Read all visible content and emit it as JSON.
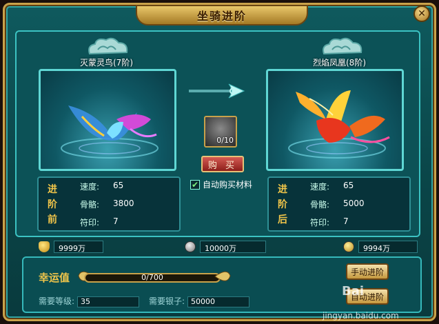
{
  "window": {
    "title": "坐骑进阶"
  },
  "left_mount": {
    "name": "灭蒙灵鸟(7阶)",
    "tag": "进\n阶\n前",
    "stats": [
      {
        "label": "速度:",
        "value": "65"
      },
      {
        "label": "骨骼:",
        "value": "3800"
      },
      {
        "label": "符印:",
        "value": "7"
      }
    ]
  },
  "right_mount": {
    "name": "烈焰凤凰(8阶)",
    "tag": "进\n阶\n后",
    "stats": [
      {
        "label": "速度:",
        "value": "65"
      },
      {
        "label": "骨骼:",
        "value": "5000"
      },
      {
        "label": "符印:",
        "value": "7"
      }
    ]
  },
  "material": {
    "count": "0/10"
  },
  "buy_button": {
    "label": "购 买"
  },
  "auto_buy": {
    "label": "自动购买材料",
    "checked": true
  },
  "currency": [
    {
      "icon": "gold-ingot-icon",
      "value": "9999万"
    },
    {
      "icon": "silver-coin-icon",
      "value": "10000万"
    },
    {
      "icon": "locked-silver-icon",
      "value": "9994万"
    }
  ],
  "luck": {
    "label": "幸运值",
    "value": "0/700"
  },
  "requirements": {
    "level_label": "需要等级:",
    "level_value": "35",
    "silver_label": "需要银子:",
    "silver_value": "50000"
  },
  "buttons": {
    "manual": "手动进阶",
    "auto": "自动进阶"
  },
  "watermark": {
    "logo": "Bai",
    "site": "jingyan.baidu.com"
  },
  "colors": {
    "frame": "#c9a24a",
    "panel": "#0c5257",
    "accent": "#3cc3c3",
    "tag_gold": "#f2c64a"
  }
}
